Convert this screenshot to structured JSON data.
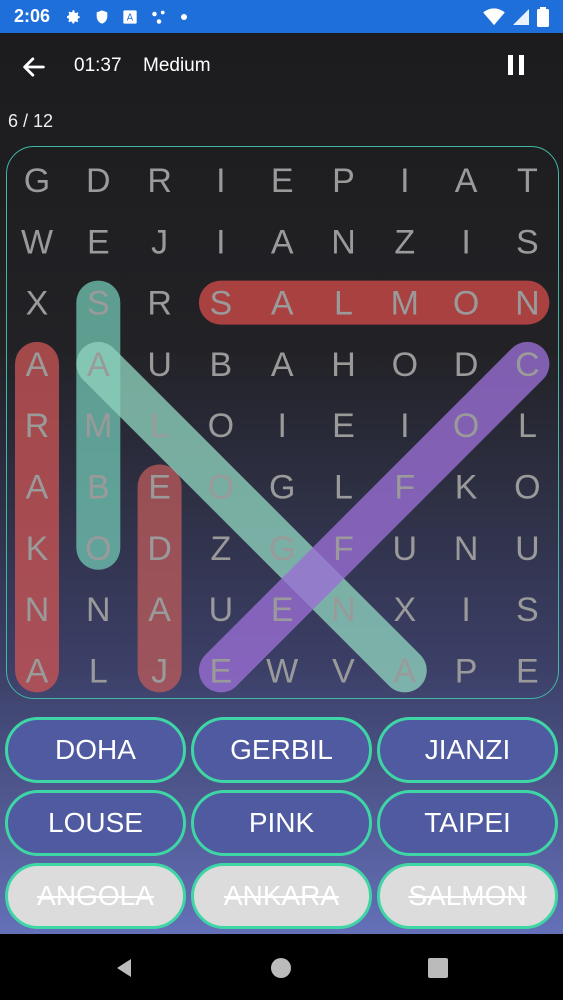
{
  "status": {
    "time": "2:06"
  },
  "toolbar": {
    "timer": "01:37",
    "difficulty": "Medium"
  },
  "progress": "6 / 12",
  "grid": [
    [
      "G",
      "D",
      "R",
      "I",
      "E",
      "P",
      "I",
      "A",
      "T"
    ],
    [
      "W",
      "E",
      "J",
      "I",
      "A",
      "N",
      "Z",
      "I",
      "S"
    ],
    [
      "X",
      "S",
      "R",
      "S",
      "A",
      "L",
      "M",
      "O",
      "N"
    ],
    [
      "A",
      "A",
      "U",
      "B",
      "A",
      "H",
      "O",
      "D",
      "C"
    ],
    [
      "R",
      "M",
      "L",
      "O",
      "I",
      "E",
      "I",
      "O",
      "L"
    ],
    [
      "A",
      "B",
      "E",
      "O",
      "G",
      "L",
      "F",
      "K",
      "O"
    ],
    [
      "K",
      "O",
      "D",
      "Z",
      "G",
      "F",
      "U",
      "N",
      "U"
    ],
    [
      "N",
      "N",
      "A",
      "U",
      "E",
      "N",
      "X",
      "I",
      "S"
    ],
    [
      "A",
      "L",
      "J",
      "E",
      "W",
      "V",
      "A",
      "P",
      "E"
    ]
  ],
  "highlights": [
    {
      "from": [
        2,
        3
      ],
      "to": [
        2,
        8
      ],
      "color": "#d14a4a"
    },
    {
      "from": [
        3,
        0
      ],
      "to": [
        8,
        0
      ],
      "color": "#c85454"
    },
    {
      "from": [
        5,
        2
      ],
      "to": [
        8,
        2
      ],
      "color": "#b85a5a"
    },
    {
      "from": [
        2,
        1
      ],
      "to": [
        6,
        1
      ],
      "color": "#6fc1b0"
    },
    {
      "from": [
        3,
        1
      ],
      "to": [
        8,
        6
      ],
      "color": "#8ed2bd"
    },
    {
      "from": [
        3,
        8
      ],
      "to": [
        8,
        3
      ],
      "color": "#9b6fd6"
    }
  ],
  "words": [
    {
      "label": "DOHA",
      "found": false
    },
    {
      "label": "GERBIL",
      "found": false
    },
    {
      "label": "JIANZI",
      "found": false
    },
    {
      "label": "LOUSE",
      "found": false
    },
    {
      "label": "PINK",
      "found": false
    },
    {
      "label": "TAIPEI",
      "found": false
    },
    {
      "label": "ANGOLA",
      "found": true
    },
    {
      "label": "ANKARA",
      "found": true
    },
    {
      "label": "SALMON",
      "found": true
    }
  ]
}
